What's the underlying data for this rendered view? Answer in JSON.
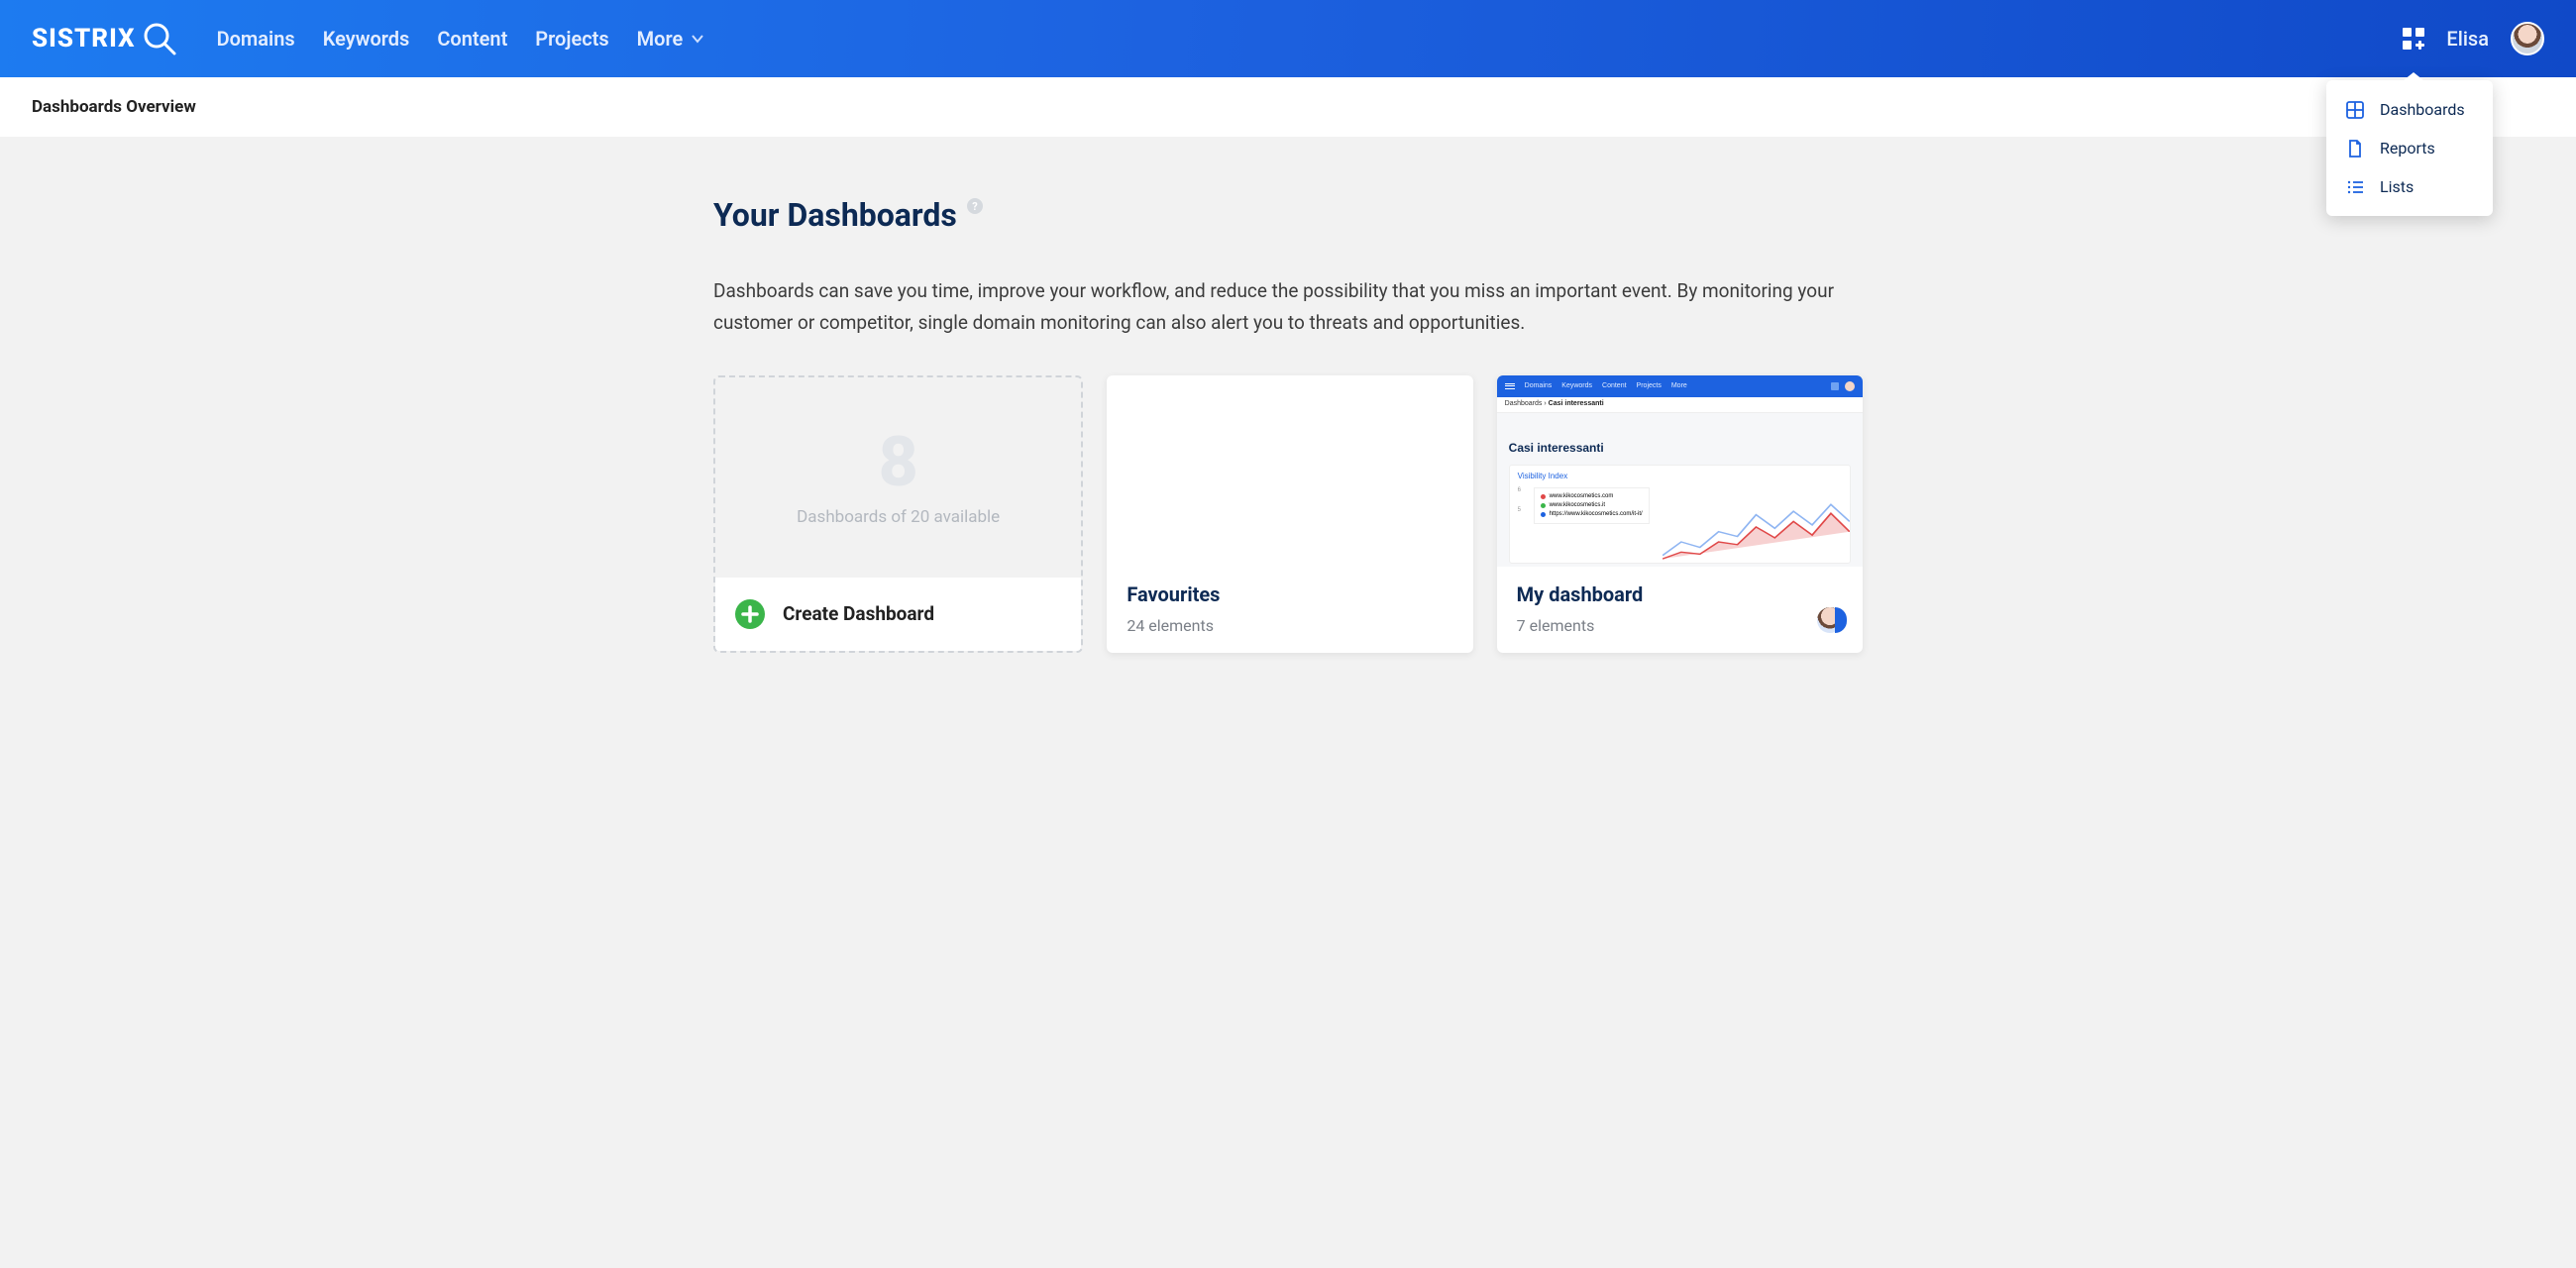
{
  "logo_text": "SISTRIX",
  "nav": {
    "domains": "Domains",
    "keywords": "Keywords",
    "content": "Content",
    "projects": "Projects",
    "more": "More"
  },
  "user": {
    "name": "Elisa"
  },
  "dropdown": {
    "dashboards": "Dashboards",
    "reports": "Reports",
    "lists": "Lists"
  },
  "subheader": {
    "title": "Dashboards Overview"
  },
  "main": {
    "title": "Your Dashboards",
    "description": "Dashboards can save you time, improve your workflow, and reduce the possibility that you miss an important event. By monitoring your customer or competitor, single domain monitoring can also alert you to threats and opportunities."
  },
  "create_card": {
    "count": "8",
    "available_text": "Dashboards of 20 available",
    "button_label": "Create Dashboard"
  },
  "cards": [
    {
      "title": "Favourites",
      "subtitle": "24 elements"
    },
    {
      "title": "My dashboard",
      "subtitle": "7 elements"
    }
  ],
  "mini_dash": {
    "nav": {
      "domains": "Domains",
      "keywords": "Keywords",
      "content": "Content",
      "projects": "Projects",
      "more": "More"
    },
    "crumb_root": "Dashboards",
    "crumb_sep": " › ",
    "crumb_current": "Casi interessanti",
    "title": "Casi interessanti",
    "panel_title": "Visibility Index",
    "axis_a": "6",
    "axis_b": "5",
    "legend": [
      {
        "color": "#e04848",
        "label": "www.kikocosmetics.com"
      },
      {
        "color": "#3bb54a",
        "label": "www.kikocosmetics.it"
      },
      {
        "color": "#1d62e0",
        "label": "https://www.kikocosmetics.com/it-it/"
      }
    ]
  }
}
